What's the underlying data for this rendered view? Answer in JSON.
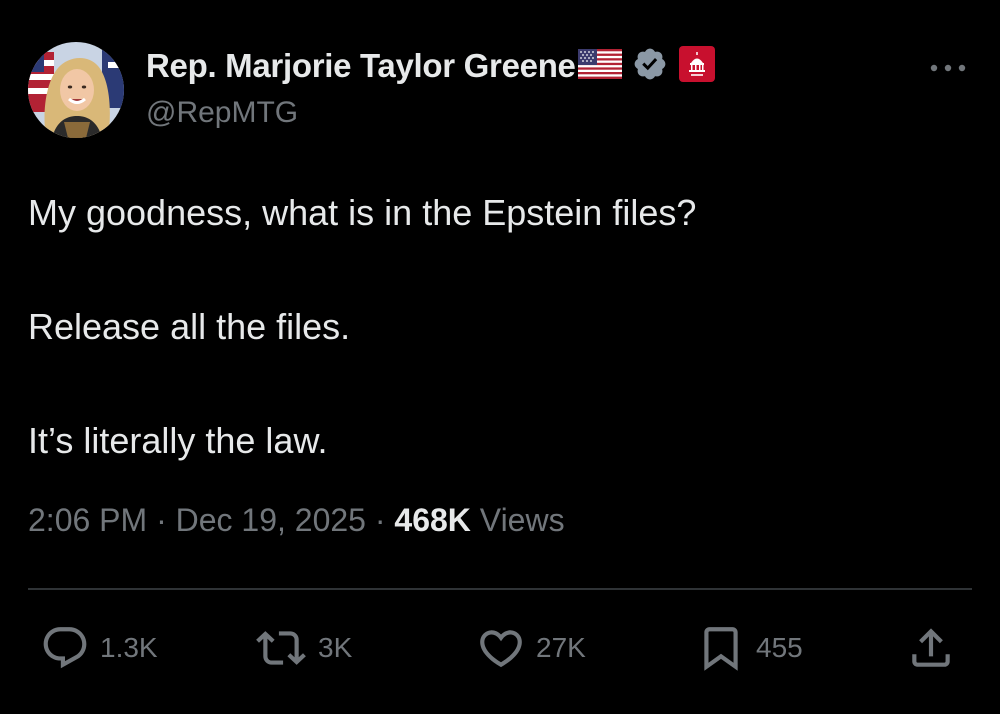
{
  "author": {
    "display_name": "Rep. Marjorie Taylor Greene",
    "handle": "@RepMTG",
    "badges": [
      "us-flag-icon",
      "verified-badge-icon",
      "government-affiliation-icon"
    ]
  },
  "tweet": {
    "paragraphs": [
      "My goodness, what is in the Epstein files?",
      "Release all the files.",
      "It’s literally the law."
    ],
    "time": "2:06 PM",
    "date": "Dec 19, 2025",
    "separator": "·",
    "views_count": "468K",
    "views_label": "Views"
  },
  "actions": {
    "replies": "1.3K",
    "reposts": "3K",
    "likes": "27K",
    "bookmarks": "455"
  },
  "colors": {
    "background": "#000000",
    "primary_text": "#e7e9ea",
    "secondary_text": "#71767b",
    "divider": "#2f3336",
    "verified": "#8b98a5",
    "gov_badge": "#c8102e"
  }
}
